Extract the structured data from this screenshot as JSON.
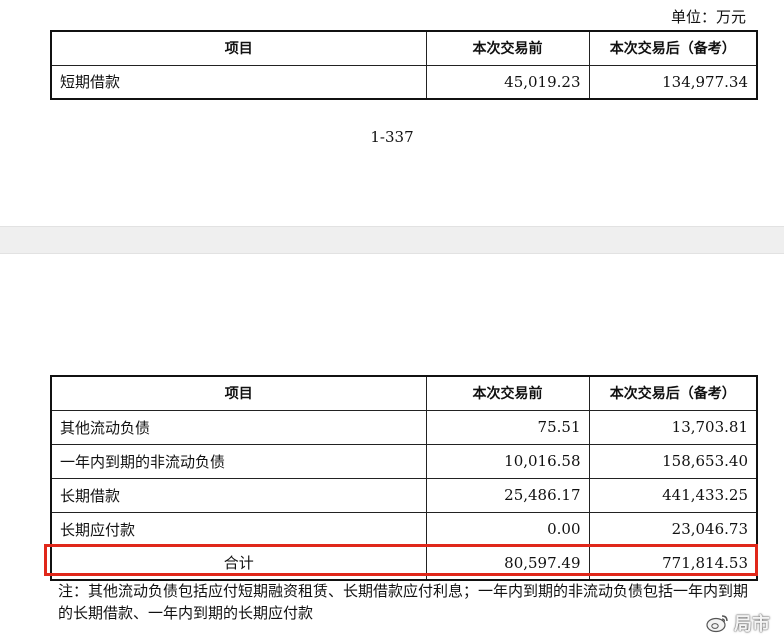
{
  "unit_label": "单位：万元",
  "table1": {
    "headers": [
      "项目",
      "本次交易前",
      "本次交易后（备考）"
    ],
    "rows": [
      [
        "短期借款",
        "45,019.23",
        "134,977.34"
      ]
    ]
  },
  "page_number": "1-337",
  "table2": {
    "headers": [
      "项目",
      "本次交易前",
      "本次交易后（备考）"
    ],
    "rows": [
      [
        "其他流动负债",
        "75.51",
        "13,703.81"
      ],
      [
        "一年内到期的非流动负债",
        "10,016.58",
        "158,653.40"
      ],
      [
        "长期借款",
        "25,486.17",
        "441,433.25"
      ],
      [
        "长期应付款",
        "0.00",
        "23,046.73"
      ]
    ],
    "total": [
      "合计",
      "80,597.49",
      "771,814.53"
    ]
  },
  "note": "注：其他流动负债包括应付短期融资租赁、长期借款应付利息；一年内到期的非流动负债包括一年内到期的长期借款、一年内到期的长期应付款",
  "watermark": "局市",
  "colors": {
    "highlight": "#e0271a",
    "gap": "#efefef"
  }
}
